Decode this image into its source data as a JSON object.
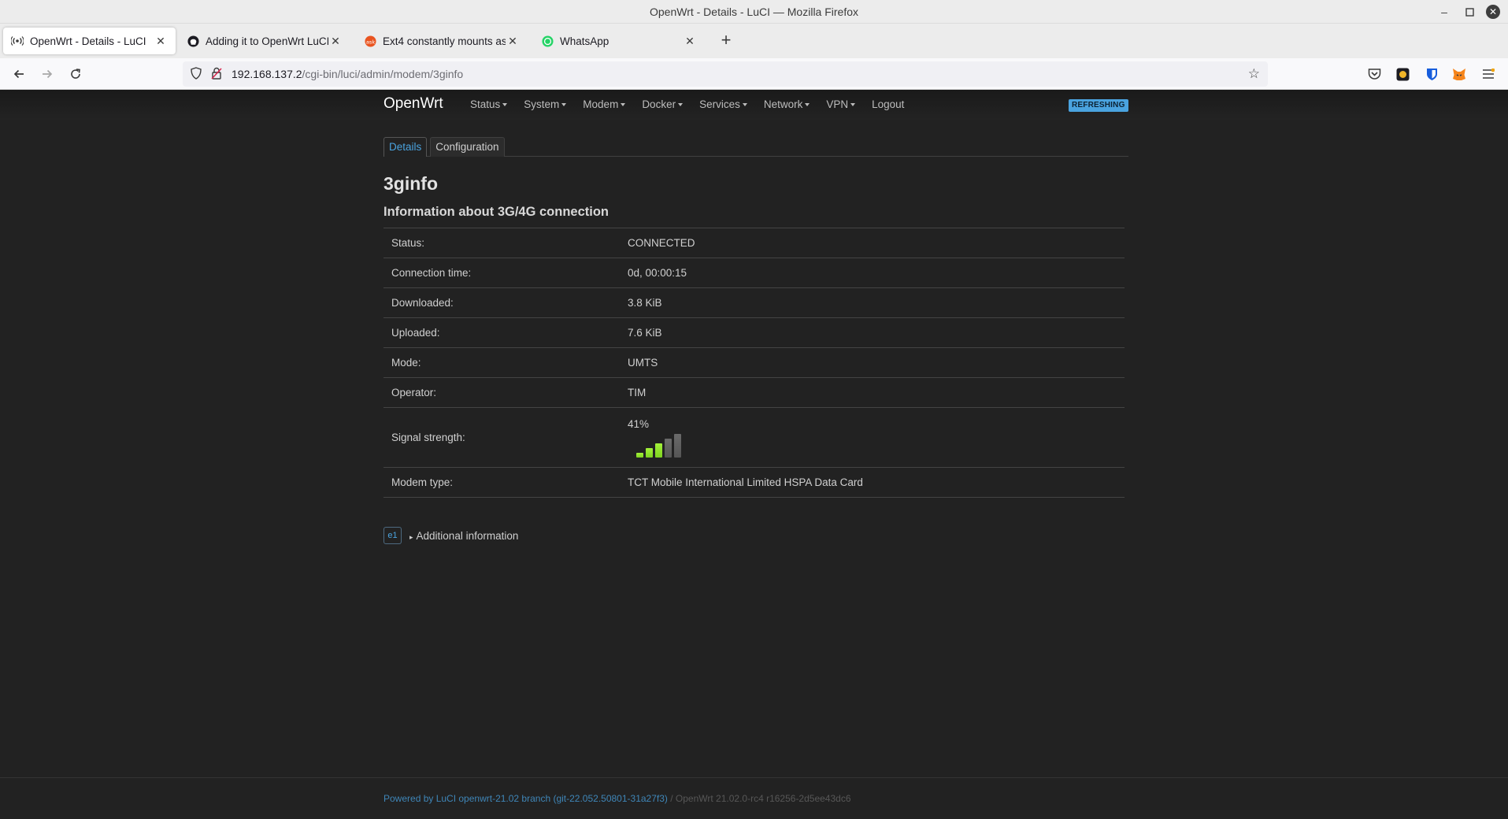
{
  "window": {
    "title": "OpenWrt - Details - LuCI — Mozilla Firefox"
  },
  "browser": {
    "tabs": [
      {
        "title": "OpenWrt - Details - LuCI",
        "icon": "broadcast-icon",
        "active": true
      },
      {
        "title": "Adding it to OpenWrt LuCI / …",
        "icon": "github-icon",
        "active": false
      },
      {
        "title": "Ext4 constantly mounts as r…",
        "icon": "askubuntu-icon",
        "active": false
      },
      {
        "title": "WhatsApp",
        "icon": "whatsapp-icon",
        "active": false
      }
    ],
    "url_host": "192.168.137.2",
    "url_path": "/cgi-bin/luci/admin/modem/3ginfo"
  },
  "luci": {
    "brand": "OpenWrt",
    "menu": [
      "Status",
      "System",
      "Modem",
      "Docker",
      "Services",
      "Network",
      "VPN"
    ],
    "logout": "Logout",
    "refresh_badge": "REFRESHING",
    "content_tabs": [
      {
        "label": "Details",
        "active": true
      },
      {
        "label": "Configuration",
        "active": false
      }
    ],
    "page_title": "3ginfo",
    "section_title": "Information about 3G/4G connection",
    "rows": [
      {
        "key": "Status:",
        "value": "CONNECTED"
      },
      {
        "key": "Connection time:",
        "value": "0d, 00:00:15"
      },
      {
        "key": "Downloaded:",
        "value": "3.8 KiB"
      },
      {
        "key": "Uploaded:",
        "value": "7.6 KiB"
      },
      {
        "key": "Mode:",
        "value": "UMTS"
      },
      {
        "key": "Operator:",
        "value": "TIM"
      },
      {
        "key": "Signal strength:",
        "value": "41%",
        "signal_percent": 41
      },
      {
        "key": "Modem type:",
        "value": "TCT Mobile International Limited HSPA Data Card"
      }
    ],
    "device_badge": "e1",
    "additional_info": "Additional information",
    "footer_powered": "Powered by LuCI openwrt-21.02 branch (git-22.052.50801-31a27f3)",
    "footer_version": " / OpenWrt 21.02.0-rc4 r16256-2d5ee43dc6"
  },
  "colors": {
    "accent": "#4aa3df",
    "background": "#222222",
    "signal_active": "#7ed321",
    "signal_inactive": "#555555"
  }
}
